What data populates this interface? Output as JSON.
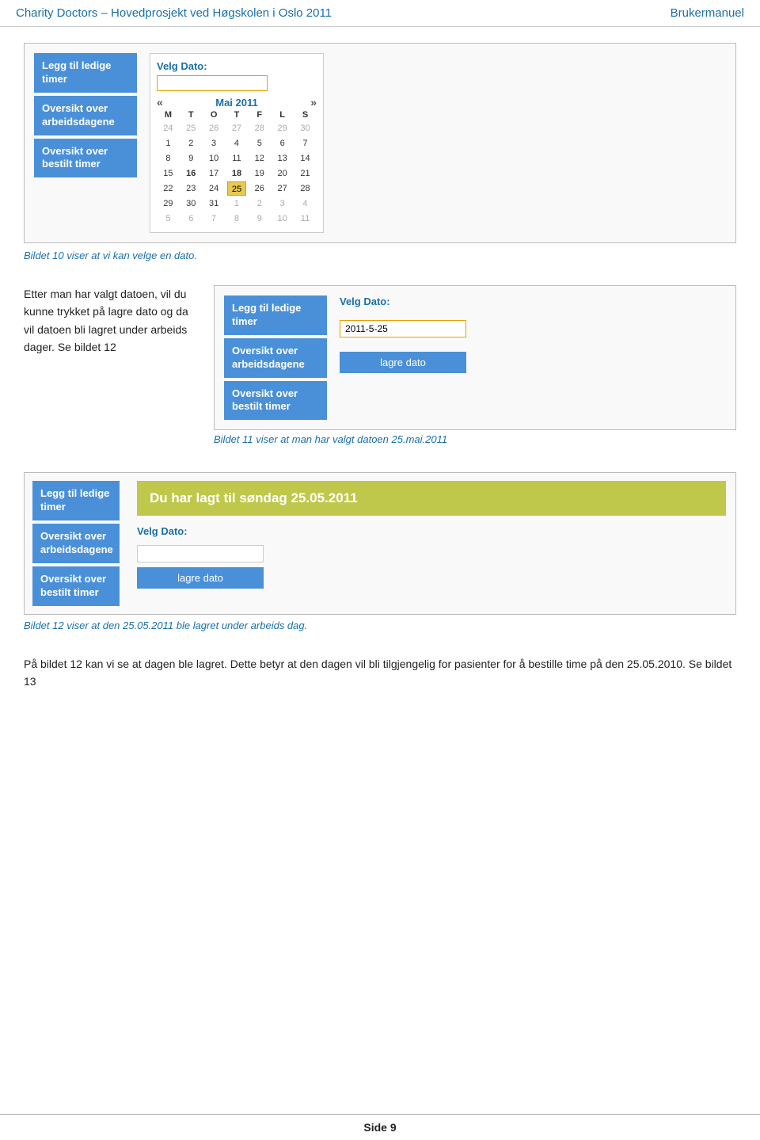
{
  "header": {
    "title": "Charity Doctors – Hovedprosjekt ved Høgskolen i Oslo 2011",
    "link": "Brukermanuel"
  },
  "nav": {
    "btn1": "Legg til ledige timer",
    "btn2": "Oversikt over arbeidsdagene",
    "btn3": "Oversikt over bestilt timer"
  },
  "section1": {
    "calendar": {
      "label": "Velg Dato:",
      "month_year": "Mai 2011",
      "days_header": [
        "M",
        "T",
        "O",
        "T",
        "F",
        "L",
        "S"
      ],
      "nav_prev": "«",
      "nav_next": "»",
      "rows": [
        [
          "24",
          "25",
          "26",
          "27",
          "28",
          "29",
          "30"
        ],
        [
          "1",
          "2",
          "3",
          "4",
          "5",
          "6",
          "7"
        ],
        [
          "8",
          "9",
          "10",
          "11",
          "12",
          "13",
          "14"
        ],
        [
          "15",
          "16",
          "17",
          "18",
          "19",
          "20",
          "21"
        ],
        [
          "22",
          "23",
          "24",
          "25",
          "26",
          "27",
          "28"
        ],
        [
          "29",
          "30",
          "31",
          "1",
          "2",
          "3",
          "4"
        ],
        [
          "5",
          "6",
          "7",
          "8",
          "9",
          "10",
          "11"
        ]
      ],
      "selected_day": "25",
      "other_month_rows": [
        0,
        5,
        6
      ]
    },
    "caption": "Bildet 10 viser at vi kan velge en dato."
  },
  "section2": {
    "text": "Etter man har valgt datoen, vil du kunne trykket på lagre dato og da vil datoen bli lagret under arbeids dager. Se bildet 12",
    "date_value": "2011-5-25",
    "lagre_label": "lagre dato",
    "caption": "Bildet 11 viser at man har valgt datoen 25.mai.2011"
  },
  "section3": {
    "banner": "Du har lagt til søndag 25.05.2011",
    "velg_label": "Velg Dato:",
    "lagre_label": "lagre dato",
    "caption": "Bildet 12 viser at den 25.05.2011 ble lagret under arbeids dag."
  },
  "body_text": "På bildet 12 kan vi se at dagen ble lagret. Dette betyr at den dagen vil bli tilgjengelig for pasienter for å bestille time på den 25.05.2010. Se bildet 13",
  "footer": {
    "label": "Side 9"
  }
}
